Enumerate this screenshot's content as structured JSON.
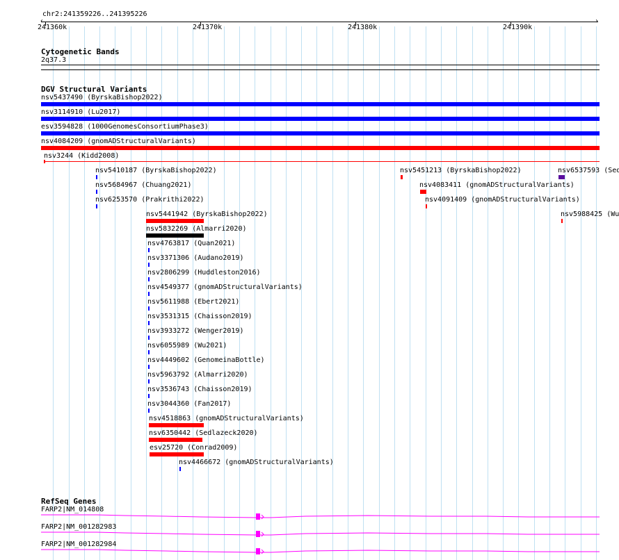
{
  "ruler": {
    "locus": "chr2:241359226..241395226",
    "start": 241359226,
    "end": 241395226,
    "ticks": [
      {
        "pos": 241360000,
        "label": "241360k"
      },
      {
        "pos": 241370000,
        "label": "241370k"
      },
      {
        "pos": 241380000,
        "label": "241380k"
      },
      {
        "pos": 241390000,
        "label": "241390k"
      }
    ]
  },
  "cytobands": {
    "title": "Cytogenetic Bands",
    "band": "2q37.3"
  },
  "dgv": {
    "title": "DGV Structural Variants",
    "features": [
      {
        "label": "nsv5437490 (ByrskaBishop2022)",
        "color": "#0000ff"
      },
      {
        "label": "nsv3114910 (Lu2017)",
        "color": "#0000ff"
      },
      {
        "label": "esv3594828 (1000GenomesConsortiumPhase3)",
        "color": "#0000ff"
      },
      {
        "label": "nsv4084209 (gnomADStructuralVariants)",
        "color": "#ff0000"
      },
      {
        "label": "nsv3244 (Kidd2008)",
        "color": "#ff0000"
      },
      {
        "label": "nsv5410187 (ByrskaBishop2022)",
        "color": "#0000ff"
      },
      {
        "label": "nsv5684967 (Chuang2021)",
        "color": "#0000ff"
      },
      {
        "label": "nsv6253570 (Prakrithi2022)",
        "color": "#0000ff"
      },
      {
        "label": "nsv5451213 (ByrskaBishop2022)",
        "color": "#ff0000"
      },
      {
        "label": "nsv4083411 (gnomADStructuralVariants)",
        "color": "#ff0000"
      },
      {
        "label": "nsv4091409 (gnomADStructuralVariants)",
        "color": "#ff0000"
      },
      {
        "label": "nsv6537593 (Sed",
        "color": "#5a0f9e"
      },
      {
        "label": "nsv5988425 (Wu",
        "color": "#ff0000"
      },
      {
        "label": "nsv5441942 (ByrskaBishop2022)",
        "color": "#ff0000"
      },
      {
        "label": "nsv5832269 (Almarri2020)",
        "color": "#000000"
      },
      {
        "label": "nsv4763817 (Quan2021)",
        "color": "#0000ff"
      },
      {
        "label": "nsv3371306 (Audano2019)",
        "color": "#0000ff"
      },
      {
        "label": "nsv2806299 (Huddleston2016)",
        "color": "#0000ff"
      },
      {
        "label": "nsv4549377 (gnomADStructuralVariants)",
        "color": "#0000ff"
      },
      {
        "label": "nsv5611988 (Ebert2021)",
        "color": "#0000ff"
      },
      {
        "label": "nsv3531315 (Chaisson2019)",
        "color": "#0000ff"
      },
      {
        "label": "nsv3933272 (Wenger2019)",
        "color": "#0000ff"
      },
      {
        "label": "nsv6055989 (Wu2021)",
        "color": "#0000ff"
      },
      {
        "label": "nsv4449602 (GenomeinaBottle)",
        "color": "#0000ff"
      },
      {
        "label": "nsv5963792 (Almarri2020)",
        "color": "#0000ff"
      },
      {
        "label": "nsv3536743 (Chaisson2019)",
        "color": "#0000ff"
      },
      {
        "label": "nsv3044360 (Fan2017)",
        "color": "#0000ff"
      },
      {
        "label": "nsv4518863 (gnomADStructuralVariants)",
        "color": "#ff0000"
      },
      {
        "label": "nsv6350442 (Sedlazeck2020)",
        "color": "#ff0000"
      },
      {
        "label": "esv25720 (Conrad2009)",
        "color": "#ff0000"
      },
      {
        "label": "nsv4466672 (gnomADStructuralVariants)",
        "color": "#0000ff"
      }
    ]
  },
  "refseq": {
    "title": "RefSeq Genes",
    "gene_color": "#ff00ff",
    "transcripts": [
      {
        "label": "FARP2|NM_014808"
      },
      {
        "label": "FARP2|NM_001282983"
      },
      {
        "label": "FARP2|NM_001282984"
      }
    ]
  }
}
